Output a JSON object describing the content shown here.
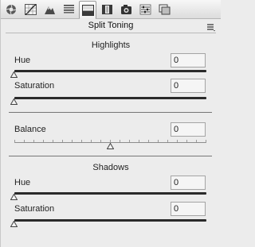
{
  "panel": {
    "title": "Split Toning",
    "tabs": [
      {
        "icon": "basic-aperture-icon",
        "active": false
      },
      {
        "icon": "tone-curve-icon",
        "active": false
      },
      {
        "icon": "detail-triangle-icon",
        "active": false
      },
      {
        "icon": "hsl-grayscale-icon",
        "active": false
      },
      {
        "icon": "split-toning-icon",
        "active": true
      },
      {
        "icon": "lens-corrections-icon",
        "active": false
      },
      {
        "icon": "effects-camera-icon",
        "active": false
      },
      {
        "icon": "camera-calibration-icon",
        "active": false
      },
      {
        "icon": "presets-icon",
        "active": false
      }
    ]
  },
  "highlights": {
    "title": "Highlights",
    "hue_label": "Hue",
    "hue_value": "0",
    "saturation_label": "Saturation",
    "saturation_value": "0"
  },
  "balance": {
    "label": "Balance",
    "value": "0"
  },
  "shadows": {
    "title": "Shadows",
    "hue_label": "Hue",
    "hue_value": "0",
    "saturation_label": "Saturation",
    "saturation_value": "0"
  }
}
